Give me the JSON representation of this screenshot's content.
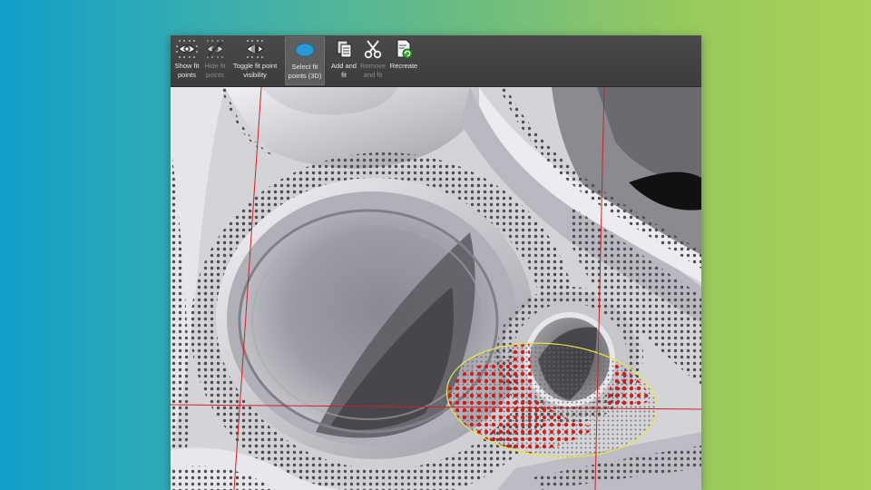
{
  "toolbar": {
    "tools": [
      {
        "label": "Show fit\npoints",
        "enabled": true,
        "icon": "eye-show-icon"
      },
      {
        "label": "Hide fit\npoints",
        "enabled": false,
        "icon": "eye-hide-icon"
      },
      {
        "label": "Toggle fit point\nvisibility",
        "enabled": true,
        "icon": "eye-toggle-icon"
      },
      {
        "label": "Select fit\npoints (3D)",
        "enabled": true,
        "active": true,
        "icon": "ellipse-select-icon",
        "has_dropdown": true
      },
      {
        "label": "Add and\nfit",
        "enabled": true,
        "icon": "document-add-icon"
      },
      {
        "label": "Remove\nand fit",
        "enabled": false,
        "icon": "scissors-icon"
      },
      {
        "label": "Recreate",
        "enabled": true,
        "icon": "recreate-icon"
      }
    ]
  },
  "viewport": {
    "crosshair_color": "#cc2222",
    "selection_ellipse_color": "#e8e840",
    "selected_point_color": "#d81818",
    "fit_point_color": "#555555"
  }
}
